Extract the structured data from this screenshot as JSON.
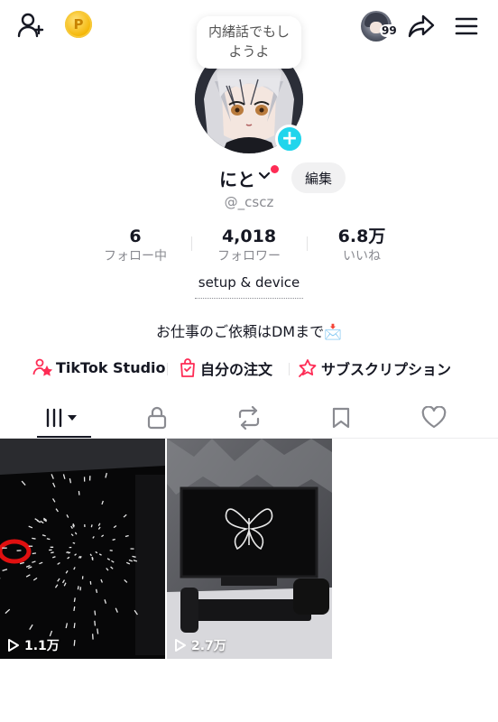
{
  "header": {
    "coin_symbol": "P",
    "notification_count": "99",
    "speech_bubble": [
      "内緒話でもし",
      "ようよ"
    ]
  },
  "profile": {
    "nickname": "にと",
    "username": "@_cscz",
    "edit_label": "編集",
    "link_text": "setup & device",
    "bio": "お仕事のご依頼はDMまで📩"
  },
  "stats": [
    {
      "value": "6",
      "label": "フォロー中"
    },
    {
      "value": "4,018",
      "label": "フォロワー"
    },
    {
      "value": "6.8万",
      "label": "いいね"
    }
  ],
  "shortcuts": [
    {
      "label": "TikTok Studio",
      "icon": "person-star-icon"
    },
    {
      "label": "自分の注文",
      "icon": "shopping-bag-icon"
    },
    {
      "label": "サブスクリプション",
      "icon": "star-ribbon-icon"
    }
  ],
  "tabs": [
    {
      "name": "videos",
      "icon": "grid-bars-icon",
      "active": true
    },
    {
      "name": "private",
      "icon": "lock-icon"
    },
    {
      "name": "reposts",
      "icon": "repost-icon"
    },
    {
      "name": "favorites",
      "icon": "bookmark-icon"
    },
    {
      "name": "liked",
      "icon": "heart-icon"
    }
  ],
  "videos": [
    {
      "views": "1.1万"
    },
    {
      "views": "2.7万"
    }
  ],
  "colors": {
    "accent_cyan": "#20d5ec",
    "accent_red": "#fe2c55",
    "text_primary": "#161823",
    "text_secondary": "#8a8b91"
  }
}
